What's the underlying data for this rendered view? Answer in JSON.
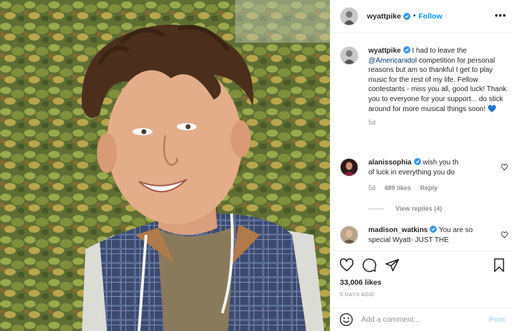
{
  "post": {
    "username": "wyattpike",
    "follow_label": "Follow",
    "dot": "•",
    "more_label": "•••"
  },
  "caption": {
    "username": "wyattpike",
    "text_before": " I had to leave the ",
    "mention": "@Americanidol",
    "text_after": " competition for personal reasons but am so thankful I get to play music for the rest of my life. Fellow contestants - miss you all, good luck! Thank you to everyone for your support... do stick around for more musical things soon! ",
    "emoji": "💙",
    "age": "5d"
  },
  "comments": [
    {
      "username": "alanissophia",
      "text": " wish you th... of luck in everything you do",
      "line1": " wish you th",
      "line2": "of luck in everything you do",
      "age": "5d",
      "likes": "489 likes",
      "reply": "Reply",
      "view_replies": "View replies (4)"
    },
    {
      "username": "madison_watkins",
      "line1": " You are so",
      "line2": "special Wyatt- JUST THE"
    }
  ],
  "actions": {
    "icons": [
      "heart-icon",
      "comment-icon",
      "share-icon",
      "bookmark-icon"
    ],
    "likes": "33,006 likes",
    "time": "5 DAYS AGO"
  },
  "add_comment": {
    "placeholder": "Add a comment...",
    "post_label": "Post"
  },
  "colors": {
    "accent": "#0095f6",
    "verified": "#3897f0",
    "post_disabled": "#b2dffc",
    "heart_blue": "#1e6fd9"
  }
}
